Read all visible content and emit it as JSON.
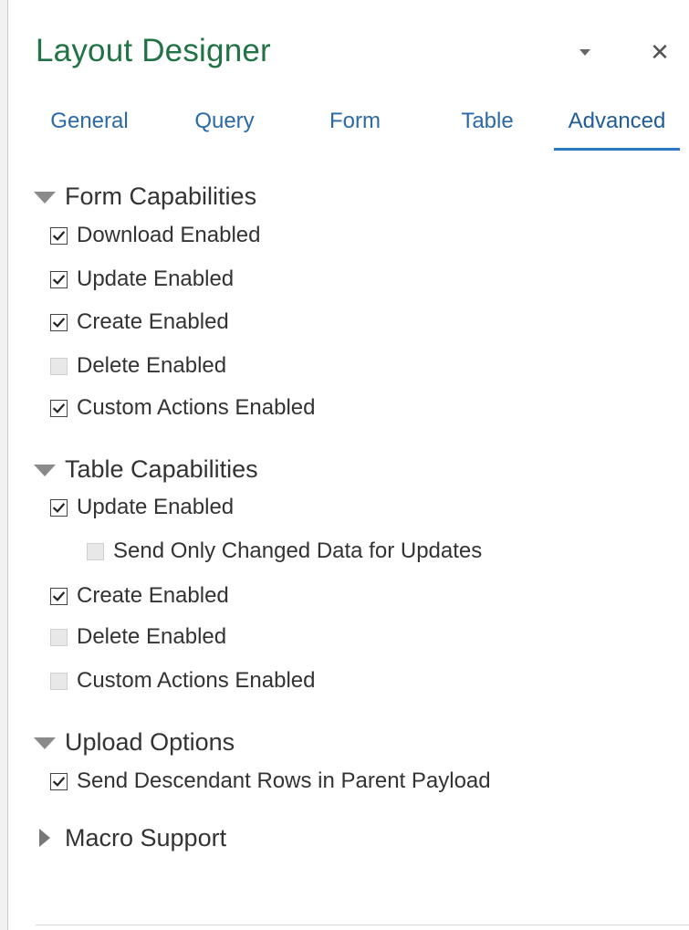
{
  "pane": {
    "title": "Layout Designer"
  },
  "header_buttons": {
    "dropdown_icon": "chevron-down-icon",
    "close_label": "✕"
  },
  "tabs": [
    {
      "label": "General",
      "active": false
    },
    {
      "label": "Query",
      "active": false
    },
    {
      "label": "Form",
      "active": false
    },
    {
      "label": "Table",
      "active": false
    },
    {
      "label": "Advanced",
      "active": true
    }
  ],
  "sections": {
    "form_capabilities": {
      "title": "Form Capabilities",
      "expanded": true,
      "items": [
        {
          "label": "Download Enabled",
          "checked": true
        },
        {
          "label": "Update Enabled",
          "checked": true
        },
        {
          "label": "Create Enabled",
          "checked": true
        },
        {
          "label": "Delete Enabled",
          "checked": false
        },
        {
          "label": "Custom Actions Enabled",
          "checked": true
        }
      ]
    },
    "table_capabilities": {
      "title": "Table Capabilities",
      "expanded": true,
      "items": [
        {
          "label": "Update Enabled",
          "checked": true
        },
        {
          "label": "Send Only Changed Data for Updates",
          "checked": false
        },
        {
          "label": "Create Enabled",
          "checked": true
        },
        {
          "label": "Delete Enabled",
          "checked": false
        },
        {
          "label": "Custom Actions Enabled",
          "checked": false
        }
      ]
    },
    "upload_options": {
      "title": "Upload Options",
      "expanded": true,
      "items": [
        {
          "label": "Send Descendant Rows in Parent Payload",
          "checked": true
        }
      ]
    },
    "macro_support": {
      "title": "Macro Support",
      "expanded": false
    }
  },
  "colors": {
    "title": "#217346",
    "tab_text": "#2b6aa8",
    "tab_active_underline": "#2b78c5"
  }
}
